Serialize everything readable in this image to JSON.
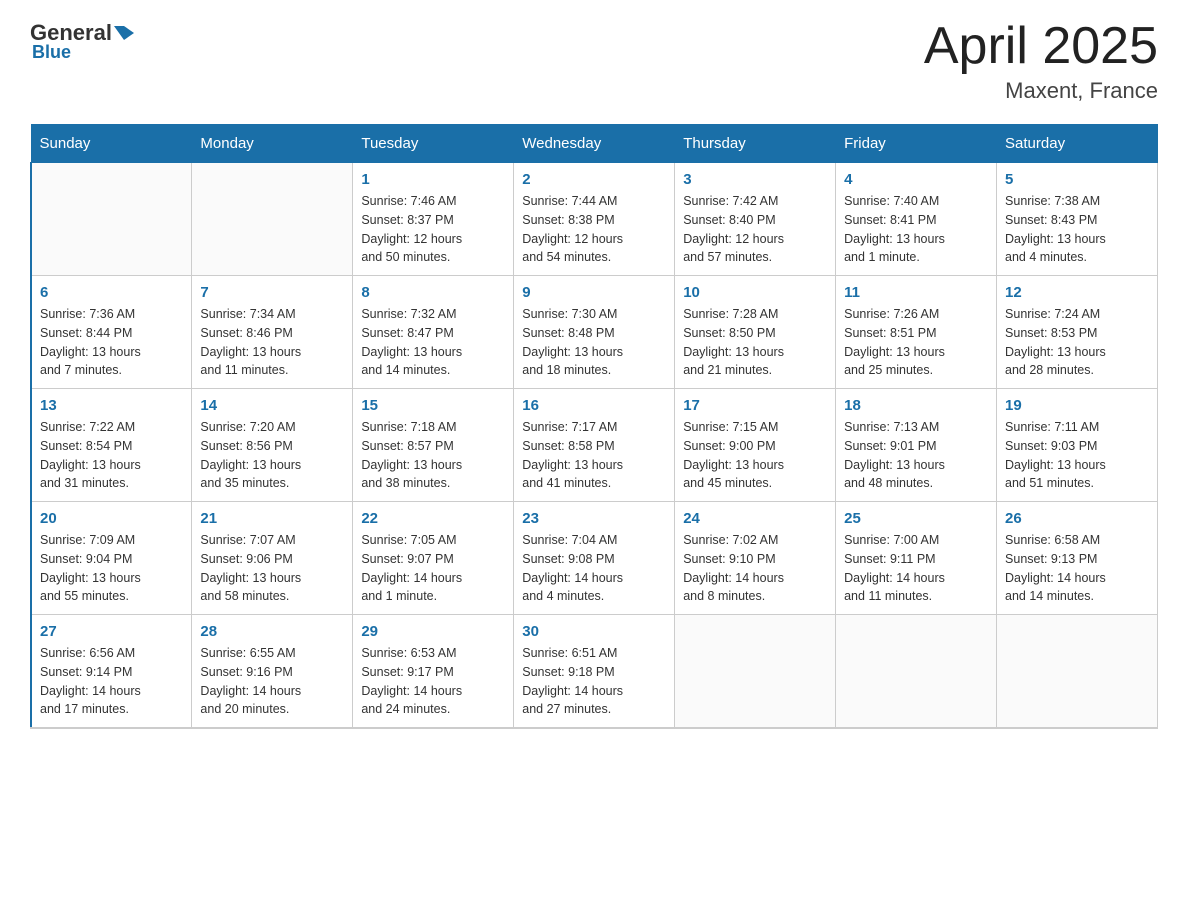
{
  "header": {
    "logo_general": "General",
    "logo_blue": "Blue",
    "month_title": "April 2025",
    "location": "Maxent, France"
  },
  "days_of_week": [
    "Sunday",
    "Monday",
    "Tuesday",
    "Wednesday",
    "Thursday",
    "Friday",
    "Saturday"
  ],
  "weeks": [
    [
      {
        "day": "",
        "info": ""
      },
      {
        "day": "",
        "info": ""
      },
      {
        "day": "1",
        "info": "Sunrise: 7:46 AM\nSunset: 8:37 PM\nDaylight: 12 hours\nand 50 minutes."
      },
      {
        "day": "2",
        "info": "Sunrise: 7:44 AM\nSunset: 8:38 PM\nDaylight: 12 hours\nand 54 minutes."
      },
      {
        "day": "3",
        "info": "Sunrise: 7:42 AM\nSunset: 8:40 PM\nDaylight: 12 hours\nand 57 minutes."
      },
      {
        "day": "4",
        "info": "Sunrise: 7:40 AM\nSunset: 8:41 PM\nDaylight: 13 hours\nand 1 minute."
      },
      {
        "day": "5",
        "info": "Sunrise: 7:38 AM\nSunset: 8:43 PM\nDaylight: 13 hours\nand 4 minutes."
      }
    ],
    [
      {
        "day": "6",
        "info": "Sunrise: 7:36 AM\nSunset: 8:44 PM\nDaylight: 13 hours\nand 7 minutes."
      },
      {
        "day": "7",
        "info": "Sunrise: 7:34 AM\nSunset: 8:46 PM\nDaylight: 13 hours\nand 11 minutes."
      },
      {
        "day": "8",
        "info": "Sunrise: 7:32 AM\nSunset: 8:47 PM\nDaylight: 13 hours\nand 14 minutes."
      },
      {
        "day": "9",
        "info": "Sunrise: 7:30 AM\nSunset: 8:48 PM\nDaylight: 13 hours\nand 18 minutes."
      },
      {
        "day": "10",
        "info": "Sunrise: 7:28 AM\nSunset: 8:50 PM\nDaylight: 13 hours\nand 21 minutes."
      },
      {
        "day": "11",
        "info": "Sunrise: 7:26 AM\nSunset: 8:51 PM\nDaylight: 13 hours\nand 25 minutes."
      },
      {
        "day": "12",
        "info": "Sunrise: 7:24 AM\nSunset: 8:53 PM\nDaylight: 13 hours\nand 28 minutes."
      }
    ],
    [
      {
        "day": "13",
        "info": "Sunrise: 7:22 AM\nSunset: 8:54 PM\nDaylight: 13 hours\nand 31 minutes."
      },
      {
        "day": "14",
        "info": "Sunrise: 7:20 AM\nSunset: 8:56 PM\nDaylight: 13 hours\nand 35 minutes."
      },
      {
        "day": "15",
        "info": "Sunrise: 7:18 AM\nSunset: 8:57 PM\nDaylight: 13 hours\nand 38 minutes."
      },
      {
        "day": "16",
        "info": "Sunrise: 7:17 AM\nSunset: 8:58 PM\nDaylight: 13 hours\nand 41 minutes."
      },
      {
        "day": "17",
        "info": "Sunrise: 7:15 AM\nSunset: 9:00 PM\nDaylight: 13 hours\nand 45 minutes."
      },
      {
        "day": "18",
        "info": "Sunrise: 7:13 AM\nSunset: 9:01 PM\nDaylight: 13 hours\nand 48 minutes."
      },
      {
        "day": "19",
        "info": "Sunrise: 7:11 AM\nSunset: 9:03 PM\nDaylight: 13 hours\nand 51 minutes."
      }
    ],
    [
      {
        "day": "20",
        "info": "Sunrise: 7:09 AM\nSunset: 9:04 PM\nDaylight: 13 hours\nand 55 minutes."
      },
      {
        "day": "21",
        "info": "Sunrise: 7:07 AM\nSunset: 9:06 PM\nDaylight: 13 hours\nand 58 minutes."
      },
      {
        "day": "22",
        "info": "Sunrise: 7:05 AM\nSunset: 9:07 PM\nDaylight: 14 hours\nand 1 minute."
      },
      {
        "day": "23",
        "info": "Sunrise: 7:04 AM\nSunset: 9:08 PM\nDaylight: 14 hours\nand 4 minutes."
      },
      {
        "day": "24",
        "info": "Sunrise: 7:02 AM\nSunset: 9:10 PM\nDaylight: 14 hours\nand 8 minutes."
      },
      {
        "day": "25",
        "info": "Sunrise: 7:00 AM\nSunset: 9:11 PM\nDaylight: 14 hours\nand 11 minutes."
      },
      {
        "day": "26",
        "info": "Sunrise: 6:58 AM\nSunset: 9:13 PM\nDaylight: 14 hours\nand 14 minutes."
      }
    ],
    [
      {
        "day": "27",
        "info": "Sunrise: 6:56 AM\nSunset: 9:14 PM\nDaylight: 14 hours\nand 17 minutes."
      },
      {
        "day": "28",
        "info": "Sunrise: 6:55 AM\nSunset: 9:16 PM\nDaylight: 14 hours\nand 20 minutes."
      },
      {
        "day": "29",
        "info": "Sunrise: 6:53 AM\nSunset: 9:17 PM\nDaylight: 14 hours\nand 24 minutes."
      },
      {
        "day": "30",
        "info": "Sunrise: 6:51 AM\nSunset: 9:18 PM\nDaylight: 14 hours\nand 27 minutes."
      },
      {
        "day": "",
        "info": ""
      },
      {
        "day": "",
        "info": ""
      },
      {
        "day": "",
        "info": ""
      }
    ]
  ]
}
